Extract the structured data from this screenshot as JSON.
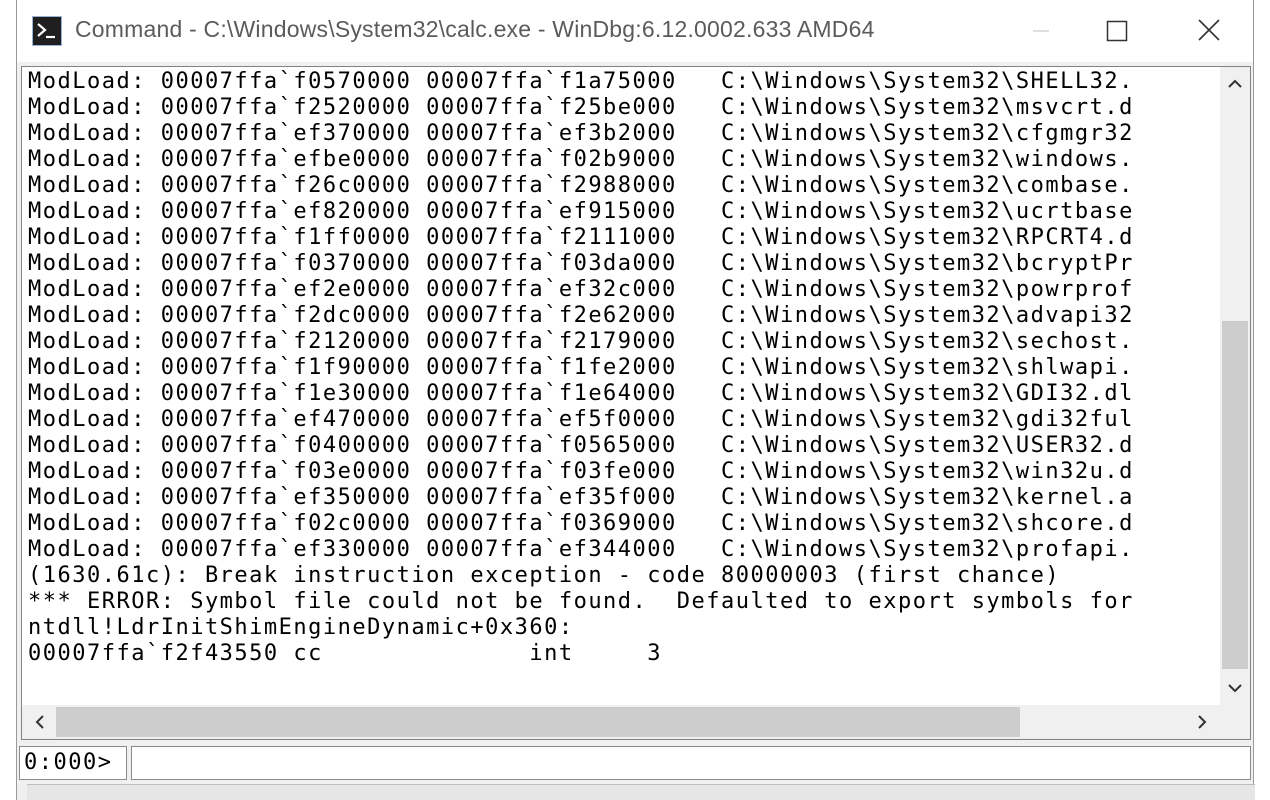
{
  "window": {
    "title": "Command - C:\\Windows\\System32\\calc.exe - WinDbg:6.12.0002.633 AMD64"
  },
  "output": {
    "lines": [
      "ModLoad: 00007ffa`f0570000 00007ffa`f1a75000   C:\\Windows\\System32\\SHELL32.",
      "ModLoad: 00007ffa`f2520000 00007ffa`f25be000   C:\\Windows\\System32\\msvcrt.d",
      "ModLoad: 00007ffa`ef370000 00007ffa`ef3b2000   C:\\Windows\\System32\\cfgmgr32",
      "ModLoad: 00007ffa`efbe0000 00007ffa`f02b9000   C:\\Windows\\System32\\windows.",
      "ModLoad: 00007ffa`f26c0000 00007ffa`f2988000   C:\\Windows\\System32\\combase.",
      "ModLoad: 00007ffa`ef820000 00007ffa`ef915000   C:\\Windows\\System32\\ucrtbase",
      "ModLoad: 00007ffa`f1ff0000 00007ffa`f2111000   C:\\Windows\\System32\\RPCRT4.d",
      "ModLoad: 00007ffa`f0370000 00007ffa`f03da000   C:\\Windows\\System32\\bcryptPr",
      "ModLoad: 00007ffa`ef2e0000 00007ffa`ef32c000   C:\\Windows\\System32\\powrprof",
      "ModLoad: 00007ffa`f2dc0000 00007ffa`f2e62000   C:\\Windows\\System32\\advapi32",
      "ModLoad: 00007ffa`f2120000 00007ffa`f2179000   C:\\Windows\\System32\\sechost.",
      "ModLoad: 00007ffa`f1f90000 00007ffa`f1fe2000   C:\\Windows\\System32\\shlwapi.",
      "ModLoad: 00007ffa`f1e30000 00007ffa`f1e64000   C:\\Windows\\System32\\GDI32.dl",
      "ModLoad: 00007ffa`ef470000 00007ffa`ef5f0000   C:\\Windows\\System32\\gdi32ful",
      "ModLoad: 00007ffa`f0400000 00007ffa`f0565000   C:\\Windows\\System32\\USER32.d",
      "ModLoad: 00007ffa`f03e0000 00007ffa`f03fe000   C:\\Windows\\System32\\win32u.d",
      "ModLoad: 00007ffa`ef350000 00007ffa`ef35f000   C:\\Windows\\System32\\kernel.a",
      "ModLoad: 00007ffa`f02c0000 00007ffa`f0369000   C:\\Windows\\System32\\shcore.d",
      "ModLoad: 00007ffa`ef330000 00007ffa`ef344000   C:\\Windows\\System32\\profapi.",
      "(1630.61c): Break instruction exception - code 80000003 (first chance)",
      "*** ERROR: Symbol file could not be found.  Defaulted to export symbols for",
      "ntdll!LdrInitShimEngineDynamic+0x360:",
      "00007ffa`f2f43550 cc              int     3"
    ]
  },
  "command": {
    "prompt": "0:000>",
    "value": ""
  }
}
